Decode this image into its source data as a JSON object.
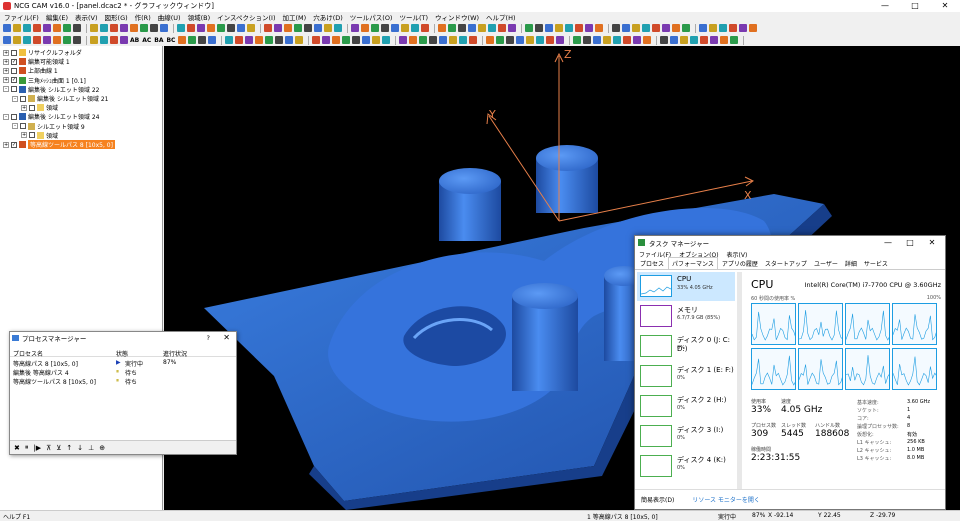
{
  "window": {
    "title": "NCG CAM v16.0 - [panel.dcac2 * - グラフィックウィンドウ]",
    "min": "—",
    "max": "□",
    "close": "✕"
  },
  "menubar": [
    "ファイル(F)",
    "編集(E)",
    "表示(V)",
    "図形(G)",
    "作(R)",
    "曲線(U)",
    "領域(B)",
    "インスペクション(I)",
    "加工(M)",
    "穴あけ(D)",
    "ツールパス(O)",
    "ツール(T)",
    "ウィンドウ(W)",
    "ヘルプ(H)"
  ],
  "toolbar_text": [
    "AB",
    "AC",
    "BA",
    "BC"
  ],
  "tree": [
    {
      "label": "リサイクルフォルダ",
      "indent": 0,
      "exp": "+",
      "check": "",
      "color": "#f0c040",
      "selected": false
    },
    {
      "label": "編集可能領域 1",
      "indent": 0,
      "exp": "+",
      "check": "✓",
      "color": "#d05020",
      "selected": false
    },
    {
      "label": "上部曲線 1",
      "indent": 0,
      "exp": "+",
      "check": "",
      "color": "#d05020",
      "selected": false
    },
    {
      "label": "三角ﾒｯｼｭ曲面 1 [0.1]",
      "indent": 0,
      "exp": "+",
      "check": "✓",
      "color": "#3a9a3a",
      "selected": false
    },
    {
      "label": "編集後 シルエット領域 22",
      "indent": 0,
      "exp": "-",
      "check": "",
      "color": "#2a5fb0",
      "selected": false
    },
    {
      "label": "編集後 シルエット領域 21",
      "indent": 1,
      "exp": "-",
      "check": "",
      "color": "#d0b050",
      "selected": false
    },
    {
      "label": "領域",
      "indent": 2,
      "exp": "+",
      "check": "",
      "color": "#f0d060",
      "selected": false
    },
    {
      "label": "編集後 シルエット領域 24",
      "indent": 0,
      "exp": "-",
      "check": "",
      "color": "#2a5fb0",
      "selected": false
    },
    {
      "label": "シルエット領域 9",
      "indent": 1,
      "exp": "-",
      "check": "",
      "color": "#d0b050",
      "selected": false
    },
    {
      "label": "領域",
      "indent": 2,
      "exp": "+",
      "check": "",
      "color": "#f0d060",
      "selected": false
    },
    {
      "label": "等高線ツールパス 8 [10x5, 0]",
      "indent": 0,
      "exp": "+",
      "check": "✓",
      "color": "#d05020",
      "selected": true
    }
  ],
  "viewport": {
    "axes": {
      "x": "X",
      "y": "Y",
      "z": "Z"
    },
    "axis_color": "#e8804a",
    "model_color": "#2f6ed0"
  },
  "process_manager": {
    "title": "プロセスマネージャー",
    "help": "?",
    "close": "✕",
    "columns": [
      "プロセス名",
      "状態",
      "進行状況"
    ],
    "rows": [
      {
        "name": "等高線パス 8 [10x5, 0]",
        "state": "実行中",
        "progress": "87%",
        "icon": "▶",
        "icon_color": "#1a3fb5"
      },
      {
        "name": "編集後 等高線パス 4",
        "state": "待ち",
        "progress": "",
        "icon": "⏸",
        "icon_color": "#b8a000"
      },
      {
        "name": "等高線ツールパス 8 [10x5, 0]",
        "state": "待ち",
        "progress": "",
        "icon": "⏸",
        "icon_color": "#b8a000"
      }
    ],
    "tools": [
      "✖",
      "⏸",
      "|▶",
      "⊼",
      "⊻",
      "↑",
      "↓",
      "⊥",
      "⊕"
    ]
  },
  "task_manager": {
    "title": "タスク マネージャー",
    "min": "—",
    "max": "□",
    "close": "✕",
    "menu": [
      "ファイル(F)",
      "オプション(O)",
      "表示(V)"
    ],
    "tabs": [
      "プロセス",
      "パフォーマンス",
      "アプリの履歴",
      "スタートアップ",
      "ユーザー",
      "詳細",
      "サービス"
    ],
    "active_tab": 1,
    "devices": [
      {
        "name": "CPU",
        "sub": "33%  4.05 GHz",
        "border": "#1d9de2",
        "active": true
      },
      {
        "name": "メモリ",
        "sub": "6.7/7.9 GB (85%)",
        "border": "#8b2fb0",
        "active": false
      },
      {
        "name": "ディスク 0 (J: C: D:)",
        "sub": "0%",
        "border": "#4caf50",
        "active": false
      },
      {
        "name": "ディスク 1 (E: F:)",
        "sub": "0%",
        "border": "#4caf50",
        "active": false
      },
      {
        "name": "ディスク 2 (H:)",
        "sub": "0%",
        "border": "#4caf50",
        "active": false
      },
      {
        "name": "ディスク 3 (I:)",
        "sub": "0%",
        "border": "#4caf50",
        "active": false
      },
      {
        "name": "ディスク 4 (K:)",
        "sub": "0%",
        "border": "#4caf50",
        "active": false
      }
    ],
    "cpu": {
      "heading": "CPU",
      "name": "Intel(R) Core(TM) i7-7700 CPU @ 3.60GHz",
      "graph_caption": "60 秒間の使用率 %",
      "graph_max": "100%",
      "usage_label": "使用率",
      "usage": "33%",
      "speed_label": "速度",
      "speed": "4.05 GHz",
      "processes_label": "プロセス数",
      "processes": "309",
      "threads_label": "スレッド数",
      "threads": "5445",
      "handles_label": "ハンドル数",
      "handles": "188608",
      "uptime_label": "稼働時間",
      "uptime": "2:23:31:55"
    },
    "specs": [
      {
        "k": "基本速度:",
        "v": "3.60 GHz"
      },
      {
        "k": "ソケット:",
        "v": "1"
      },
      {
        "k": "コア:",
        "v": "4"
      },
      {
        "k": "論理プロセッサ数:",
        "v": "8"
      },
      {
        "k": "仮想化:",
        "v": "有効"
      },
      {
        "k": "L1 キャッシュ:",
        "v": "256 KB"
      },
      {
        "k": "L2 キャッシュ:",
        "v": "1.0 MB"
      },
      {
        "k": "L3 キャッシュ:",
        "v": "8.0 MB"
      }
    ],
    "footer_less": "簡易表示(D)",
    "footer_link": "リソース モニターを開く"
  },
  "status": {
    "help": "ヘルプ F1",
    "task": "1  等高線パス 8 [10x5, 0]",
    "state": "実行中",
    "percent": "87%",
    "x": "X  -92.14",
    "y": "Y  22.45",
    "z": "Z  -29.79"
  }
}
